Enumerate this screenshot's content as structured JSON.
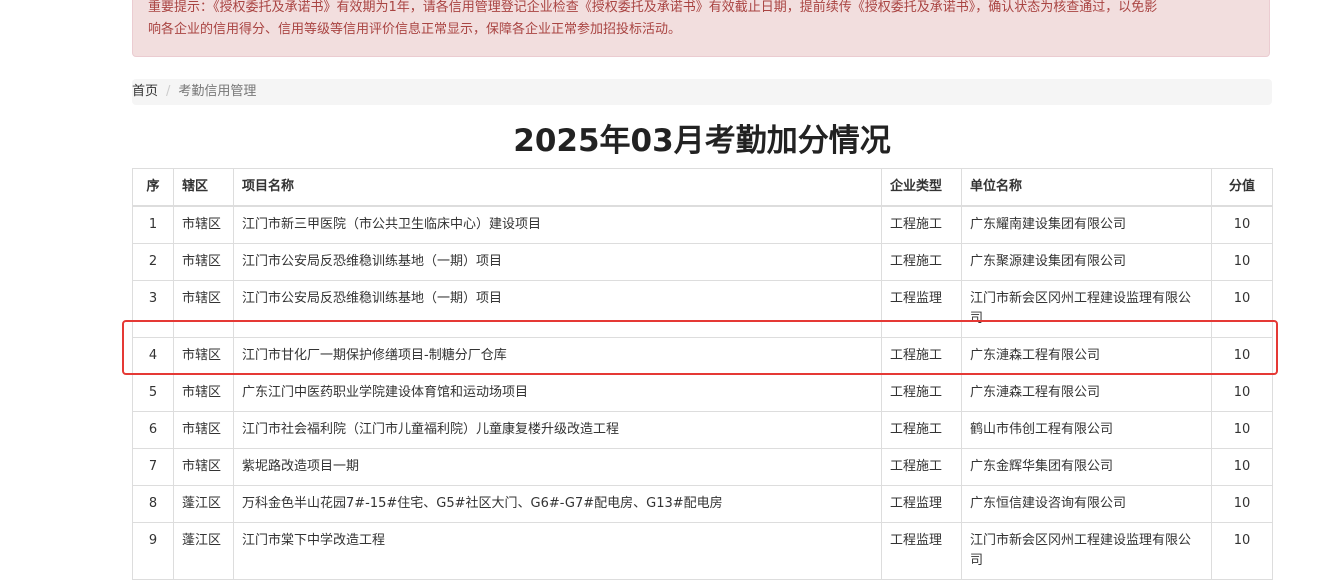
{
  "alert": {
    "line1": "重要提示：《授权委托及承诺书》有效期为1年，请各信用管理登记企业检查《授权委托及承诺书》有效截止日期，提前续传《授权委托及承诺书》，确认状态为核查通过，以免影",
    "line2": "响各企业的信用得分、信用等级等信用评价信息正常显示，保障各企业正常参加招投标活动。"
  },
  "breadcrumb": {
    "home": "首页",
    "separator": "/",
    "current": "考勤信用管理"
  },
  "page_title": "2025年03月考勤加分情况",
  "table": {
    "headers": {
      "seq": "序",
      "district": "辖区",
      "project": "项目名称",
      "type": "企业类型",
      "unit": "单位名称",
      "score": "分值"
    },
    "rows": [
      {
        "seq": "1",
        "district": "市辖区",
        "project": "江门市新三甲医院（市公共卫生临床中心）建设项目",
        "type": "工程施工",
        "unit": "广东耀南建设集团有限公司",
        "score": "10"
      },
      {
        "seq": "2",
        "district": "市辖区",
        "project": "江门市公安局反恐维稳训练基地（一期）项目",
        "type": "工程施工",
        "unit": "广东聚源建设集团有限公司",
        "score": "10"
      },
      {
        "seq": "3",
        "district": "市辖区",
        "project": "江门市公安局反恐维稳训练基地（一期）项目",
        "type": "工程监理",
        "unit": "江门市新会区冈州工程建设监理有限公司",
        "score": "10"
      },
      {
        "seq": "4",
        "district": "市辖区",
        "project": "江门市甘化厂一期保护修缮项目-制糖分厂仓库",
        "type": "工程施工",
        "unit": "广东漣森工程有限公司",
        "score": "10"
      },
      {
        "seq": "5",
        "district": "市辖区",
        "project": "广东江门中医药职业学院建设体育馆和运动场项目",
        "type": "工程施工",
        "unit": "广东漣森工程有限公司",
        "score": "10"
      },
      {
        "seq": "6",
        "district": "市辖区",
        "project": "江门市社会福利院（江门市儿童福利院）儿童康复楼升级改造工程",
        "type": "工程施工",
        "unit": "鹤山市伟创工程有限公司",
        "score": "10"
      },
      {
        "seq": "7",
        "district": "市辖区",
        "project": "紫坭路改造项目一期",
        "type": "工程施工",
        "unit": "广东金辉华集团有限公司",
        "score": "10"
      },
      {
        "seq": "8",
        "district": "蓬江区",
        "project": "万科金色半山花园7#-15#住宅、G5#社区大门、G6#-G7#配电房、G13#配电房",
        "type": "工程监理",
        "unit": "广东恒信建设咨询有限公司",
        "score": "10"
      },
      {
        "seq": "9",
        "district": "蓬江区",
        "project": "江门市棠下中学改造工程",
        "type": "工程监理",
        "unit": "江门市新会区冈州工程建设监理有限公司",
        "score": "10"
      }
    ]
  },
  "colors": {
    "alert_bg": "#f2dede",
    "alert_text": "#a94442",
    "highlight": "#e53935"
  }
}
